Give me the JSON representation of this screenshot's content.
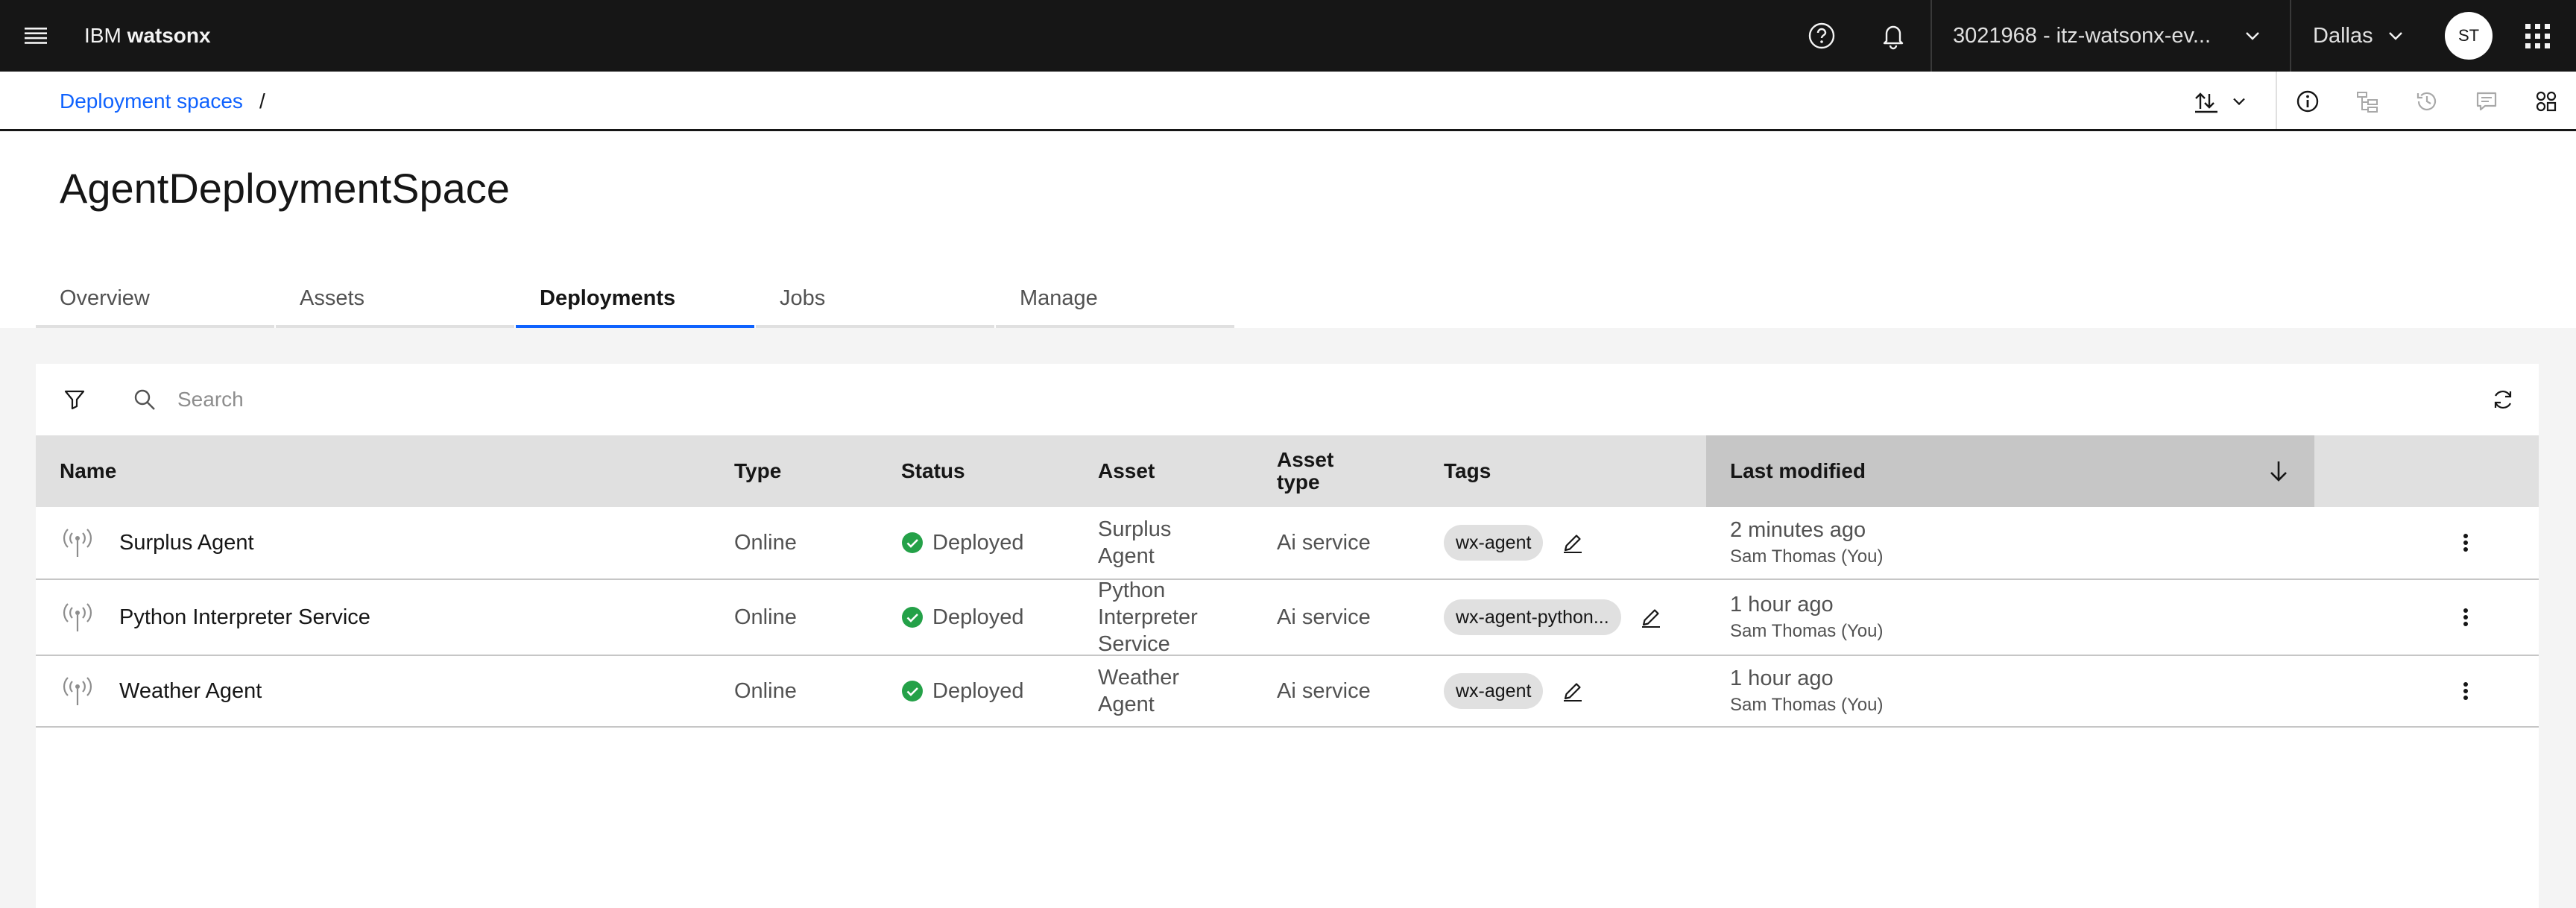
{
  "app": {
    "brand_prefix": "IBM",
    "brand_name": "watsonx"
  },
  "header": {
    "account": "3021968 - itz-watsonx-ev...",
    "region": "Dallas",
    "avatar_initials": "ST",
    "icons": [
      "menu-icon",
      "help-icon",
      "notification-icon",
      "chevron-down-icon",
      "app-switcher-icon"
    ]
  },
  "breadcrumb": {
    "parent": "Deployment spaces",
    "separator": "/"
  },
  "page": {
    "title": "AgentDeploymentSpace"
  },
  "tabs": [
    {
      "label": "Overview",
      "active": false
    },
    {
      "label": "Assets",
      "active": false
    },
    {
      "label": "Deployments",
      "active": true
    },
    {
      "label": "Jobs",
      "active": false
    },
    {
      "label": "Manage",
      "active": false
    }
  ],
  "toolbar": {
    "search_placeholder": "Search"
  },
  "table": {
    "columns": {
      "name": "Name",
      "type": "Type",
      "status": "Status",
      "asset": "Asset",
      "asset_type": "Asset type",
      "tags": "Tags",
      "last_modified": "Last modified"
    },
    "sort": {
      "column": "last_modified",
      "direction": "descending"
    },
    "rows": [
      {
        "name": "Surplus Agent",
        "type": "Online",
        "status": "Deployed",
        "asset": "Surplus Agent",
        "asset_type": "Ai service",
        "tag": "wx-agent",
        "modified": "2 minutes ago",
        "modified_by": "Sam Thomas (You)"
      },
      {
        "name": "Python Interpreter Service",
        "type": "Online",
        "status": "Deployed",
        "asset": "Python Interpreter Service",
        "asset_type": "Ai service",
        "tag": "wx-agent-python...",
        "modified": "1 hour ago",
        "modified_by": "Sam Thomas (You)"
      },
      {
        "name": "Weather Agent",
        "type": "Online",
        "status": "Deployed",
        "asset": "Weather Agent",
        "asset_type": "Ai service",
        "tag": "wx-agent",
        "modified": "1 hour ago",
        "modified_by": "Sam Thomas (You)"
      }
    ]
  },
  "colors": {
    "header_bg": "#161616",
    "link": "#0f62fe",
    "active_tab": "#0f62fe",
    "status_success": "#24a148",
    "table_header": "#e0e0e0",
    "sorted_header": "#c6c6c6"
  }
}
